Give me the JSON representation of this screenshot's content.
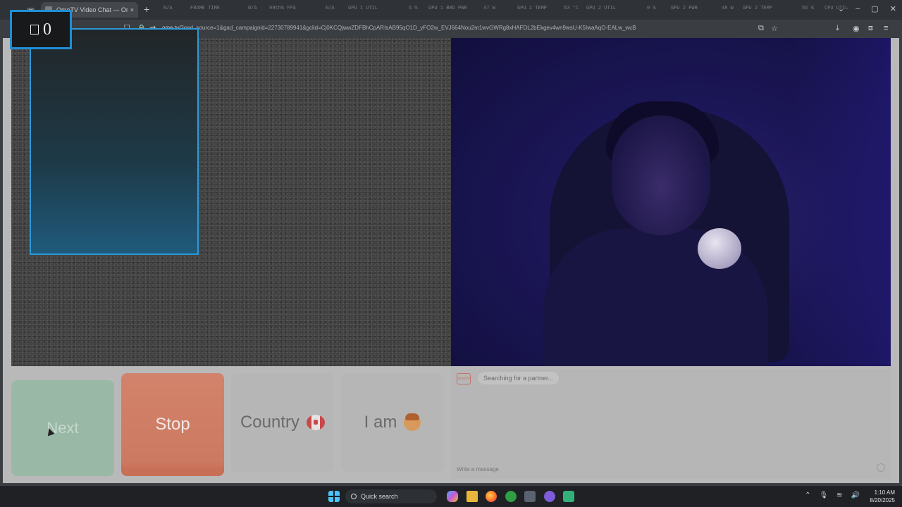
{
  "browser": {
    "tab_title": "OmeTV Video Chat — Omegle",
    "url_prefix": "ome.tv/",
    "url_query": "?gad_source=1&gad_campaignid=22730789941&gclid=Cj0KCQjwwZDFBhCpARIsAB95qO1D_yFO2w_EVJ664Nou2m1wvGWRg8xHAFDL2bEkgev4wn9wsU-K5IwaAqO-EALw_wcB"
  },
  "overlay": {
    "stats": [
      {
        "label": "N/A"
      },
      {
        "label": "FRAME TIME"
      },
      {
        "label": "N/A"
      },
      {
        "label": "99th% FPS"
      },
      {
        "label": "N/A"
      },
      {
        "label": "GPU 1 UTIL"
      },
      {
        "label": "6 %"
      },
      {
        "label": "GPU 1 BRD PWR"
      },
      {
        "label": "47 W"
      },
      {
        "label": "GPU 1 TEMP"
      },
      {
        "label": "63 °C"
      },
      {
        "label": "GPU 2 UTIL"
      },
      {
        "label": "0 %"
      },
      {
        "label": "GPU 2 PWR"
      },
      {
        "label": "48 W"
      },
      {
        "label": "GPU 2 TEMP"
      },
      {
        "label": "56 %"
      },
      {
        "label": "CPU UTIL"
      }
    ]
  },
  "counter": {
    "value": "0"
  },
  "buttons": {
    "next": "Next",
    "stop": "Stop",
    "country": "Country",
    "iam": "I am"
  },
  "chat": {
    "logo_text": "OmeTV",
    "status": "Searching for a partner...",
    "input_placeholder": "Write a message"
  },
  "taskbar": {
    "search_label": "Quick search",
    "time": "1:10 AM",
    "date": "8/20/2025"
  },
  "colors": {
    "accent_blue": "#1e8fd6",
    "stop_button": "#cc7a61",
    "next_button": "#9ab8a6"
  }
}
